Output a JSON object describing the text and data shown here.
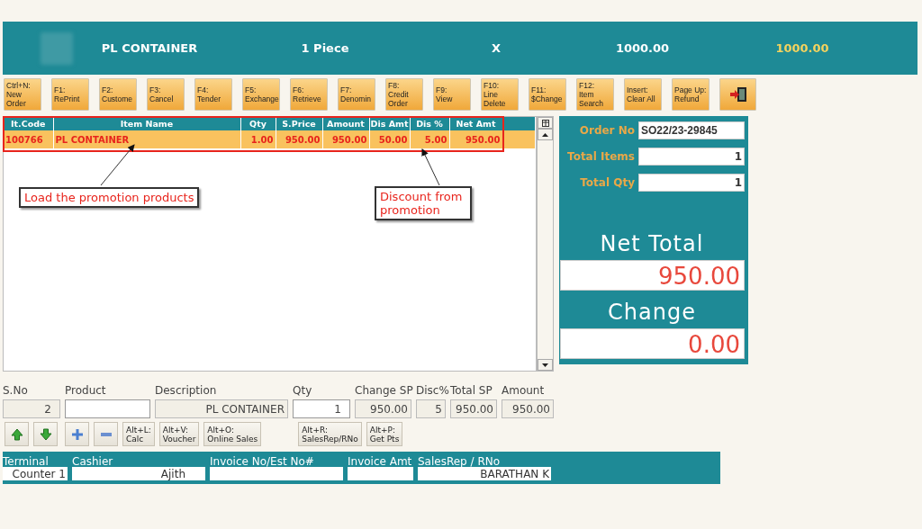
{
  "banner": {
    "product": "PL CONTAINER",
    "quantity": "1 Piece",
    "multiply": "X",
    "price": "1000.00",
    "total": "1000.00"
  },
  "toolbar": [
    {
      "kind": "text",
      "lines": [
        "Ctrl+N:",
        "New",
        "Order"
      ]
    },
    {
      "kind": "text",
      "lines": [
        "F1:",
        "RePrint"
      ]
    },
    {
      "kind": "text",
      "lines": [
        "F2:",
        "Custome"
      ]
    },
    {
      "kind": "text",
      "lines": [
        "F3:",
        "Cancel"
      ]
    },
    {
      "kind": "text",
      "lines": [
        "F4:",
        "Tender"
      ]
    },
    {
      "kind": "text",
      "lines": [
        "F5:",
        "Exchange"
      ]
    },
    {
      "kind": "text",
      "lines": [
        "F6:",
        "Retrieve"
      ]
    },
    {
      "kind": "text",
      "lines": [
        "F7:",
        "Denomin"
      ]
    },
    {
      "kind": "text",
      "lines": [
        "F8:",
        "Credit",
        "Order"
      ]
    },
    {
      "kind": "text",
      "lines": [
        "F9:",
        "View"
      ]
    },
    {
      "kind": "text",
      "lines": [
        "F10:",
        "Line",
        "Delete"
      ]
    },
    {
      "kind": "text",
      "lines": [
        "F11:",
        "$Change"
      ]
    },
    {
      "kind": "text",
      "lines": [
        "F12:",
        "Item",
        "Search"
      ]
    },
    {
      "kind": "text",
      "lines": [
        "Insert:",
        "Clear All"
      ]
    },
    {
      "kind": "text",
      "lines": [
        "Page Up:",
        "Refund"
      ]
    },
    {
      "kind": "exit"
    }
  ],
  "grid": {
    "columns": [
      "It.Code",
      "Item Name",
      "Qty",
      "S.Price",
      "Amount",
      "Dis Amt",
      "Dis %",
      "Net Amt"
    ],
    "rows": [
      {
        "cells": [
          "100766",
          "PL CONTAINER",
          "1.00",
          "950.00",
          "950.00",
          "50.00",
          "5.00",
          "950.00"
        ],
        "selected": true
      }
    ]
  },
  "annotations": [
    {
      "text": "Load the promotion products"
    },
    {
      "text": "Discount from promotion"
    }
  ],
  "summary": {
    "order_no": {
      "label": "Order No",
      "value": "SO22/23-29845"
    },
    "total_items": {
      "label": "Total Items",
      "value": "1"
    },
    "total_qty": {
      "label": "Total Qty",
      "value": "1"
    },
    "net_total": {
      "label": "Net Total",
      "value": "950.00"
    },
    "change": {
      "label": "Change",
      "value": "0.00"
    }
  },
  "entry": [
    {
      "label": "S.No",
      "value": "2",
      "kind": "readonly"
    },
    {
      "label": "Product",
      "kind": "input"
    },
    {
      "label": "Description",
      "value": "PL CONTAINER",
      "kind": "readonly"
    },
    {
      "label": "Qty",
      "value": "1",
      "kind": "input"
    },
    {
      "label": "Change SP",
      "value": "950.00",
      "kind": "readonly"
    },
    {
      "label": "Disc%",
      "value": "5",
      "kind": "readonly"
    },
    {
      "label": "Total SP",
      "value": "950.00",
      "kind": "readonly"
    },
    {
      "label": "Amount",
      "value": "950.00",
      "kind": "readonly"
    }
  ],
  "actions": [
    {
      "kind": "up"
    },
    {
      "kind": "down"
    },
    {
      "kind": "plus"
    },
    {
      "kind": "minus"
    },
    {
      "kind": "text",
      "lines": [
        "Alt+L:",
        "Calc"
      ]
    },
    {
      "kind": "text",
      "lines": [
        "Alt+V:",
        "Voucher"
      ]
    },
    {
      "kind": "text",
      "lines": [
        "Alt+O:",
        "Online Sales"
      ]
    },
    {
      "kind": "text",
      "lines": [
        "Alt+R:",
        "SalesRep/RNo"
      ]
    },
    {
      "kind": "text",
      "lines": [
        "Alt+P:",
        "Get Pts"
      ]
    }
  ],
  "footer": [
    {
      "label": "Terminal",
      "value": "Counter 1"
    },
    {
      "label": "Cashier",
      "value": "Ajith"
    },
    {
      "label": "Invoice No/Est No#"
    },
    {
      "label": "Invoice Amt"
    },
    {
      "label": "SalesRep / RNo",
      "value": "BARATHAN K"
    }
  ]
}
